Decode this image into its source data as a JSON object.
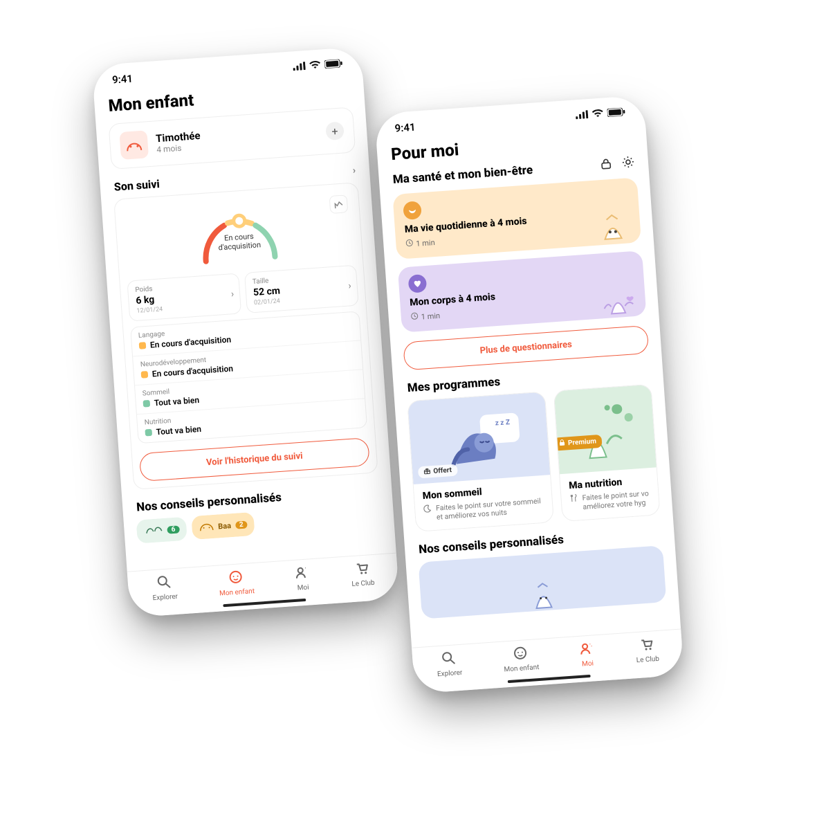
{
  "common": {
    "time": "9:41",
    "tabs": {
      "explorer": "Explorer",
      "mon_enfant": "Mon enfant",
      "moi": "Moi",
      "le_club": "Le Club"
    }
  },
  "left": {
    "title": "Mon enfant",
    "child": {
      "name": "Timothée",
      "age": "4 mois"
    },
    "suivi_header": "Son suivi",
    "gauge_label_1": "En cours",
    "gauge_label_2": "d'acquisition",
    "metrics": {
      "poids": {
        "label": "Poids",
        "value": "6 kg",
        "date": "12/01/24"
      },
      "taille": {
        "label": "Taille",
        "value": "52 cm",
        "date": "02/01/24"
      }
    },
    "status": {
      "langage": {
        "label": "Langage",
        "value": "En cours d'acquisition",
        "state": "warn"
      },
      "neuro": {
        "label": "Neurodéveloppement",
        "value": "En cours d'acquisition",
        "state": "warn"
      },
      "sommeil": {
        "label": "Sommeil",
        "value": "Tout va bien",
        "state": "ok"
      },
      "nutrition": {
        "label": "Nutrition",
        "value": "Tout va bien",
        "state": "ok"
      }
    },
    "history_btn": "Voir l'historique du suivi",
    "conseils_header": "Nos conseils personnalisés",
    "chip_badge_1": "6",
    "chip_text_2": "Baa",
    "chip_badge_2": "2"
  },
  "right": {
    "title": "Pour moi",
    "section_health": "Ma santé et mon bien-être",
    "quest1": {
      "title": "Ma vie quotidienne à 4 mois",
      "meta": "1 min"
    },
    "quest2": {
      "title": "Mon corps à 4 mois",
      "meta": "1 min"
    },
    "more_btn": "Plus de questionnaires",
    "section_programs": "Mes programmes",
    "prog1": {
      "tag": "Offert",
      "title": "Mon sommeil",
      "desc": "Faites le point sur votre sommeil et améliorez vos nuits"
    },
    "prog2": {
      "tag": "Premium",
      "title": "Ma nutrition",
      "desc": "Faites le point sur vo améliorez votre hyg"
    },
    "section_conseils": "Nos conseils personnalisés"
  },
  "colors": {
    "accent": "#f05a3c",
    "warn": "#ffb84d",
    "ok": "#7ec9a6",
    "premium": "#e0961a"
  }
}
